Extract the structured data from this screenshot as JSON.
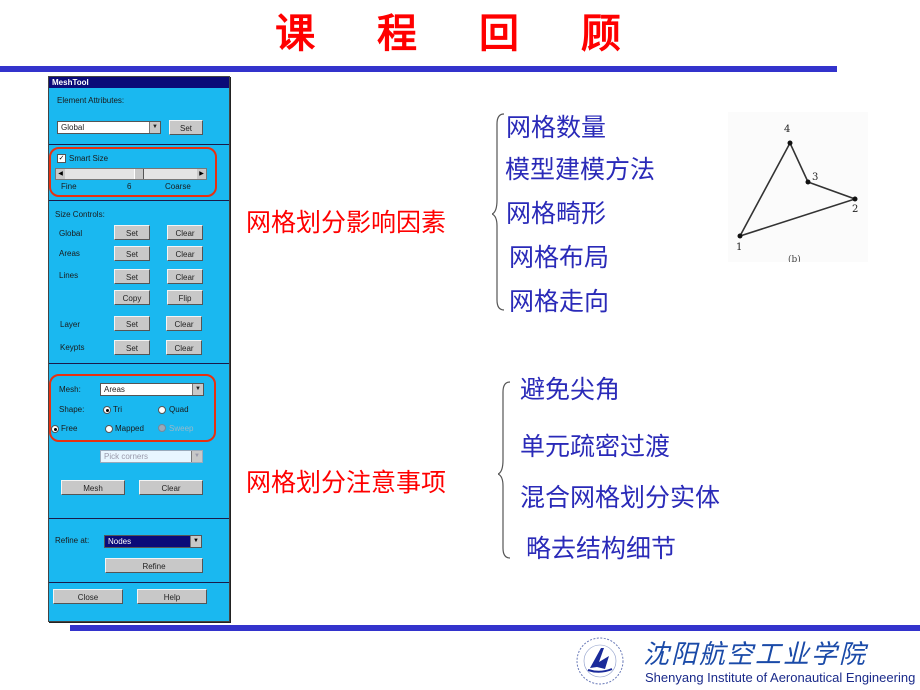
{
  "slide": {
    "title": "课 程 回 顾",
    "accent_color": "#3333cc",
    "title_color": "#ff0000",
    "item_color": "#2a2ab8"
  },
  "meshtool": {
    "window_title": "MeshTool",
    "element_attributes": {
      "label": "Element Attributes:",
      "select_value": "Global",
      "set_label": "Set"
    },
    "smart_size": {
      "checkbox_label": "Smart Size",
      "checked": true,
      "min_label": "Fine",
      "max_label": "Coarse",
      "value": "6",
      "min": 1,
      "max": 10
    },
    "size_controls": {
      "label": "Size Controls:",
      "rows": [
        {
          "label": "Global",
          "left_button": "Set",
          "right_button": "Clear"
        },
        {
          "label": "Areas",
          "left_button": "Set",
          "right_button": "Clear"
        },
        {
          "label": "Lines",
          "left_button": "Set",
          "right_button": "Clear"
        },
        {
          "label": "",
          "left_button": "Copy",
          "right_button": "Flip"
        },
        {
          "label": "Layer",
          "left_button": "Set",
          "right_button": "Clear"
        },
        {
          "label": "Keypts",
          "left_button": "Set",
          "right_button": "Clear"
        }
      ]
    },
    "mesh": {
      "label": "Mesh:",
      "select_value": "Areas",
      "shape_label": "Shape:",
      "shape_options": [
        {
          "label": "Tri",
          "selected": true
        },
        {
          "label": "Quad",
          "selected": false
        }
      ],
      "method_options": [
        {
          "label": "Free",
          "selected": true
        },
        {
          "label": "Mapped",
          "selected": false
        },
        {
          "label": "Sweep",
          "selected": false,
          "disabled": true
        }
      ],
      "pick_corners": "Pick corners",
      "mesh_button": "Mesh",
      "clear_button": "Clear"
    },
    "refine": {
      "label": "Refine at:",
      "select_value": "Nodes",
      "refine_button": "Refine"
    },
    "close_button": "Close",
    "help_button": "Help"
  },
  "factors": {
    "heading": "网格划分影响因素",
    "items": [
      "网格数量",
      "模型建模方法",
      "网格畸形",
      "网格布局",
      "网格走向"
    ]
  },
  "notes": {
    "heading": "网格划分注意事项",
    "items": [
      "避免尖角",
      "单元疏密过渡",
      "混合网格划分实体",
      "略去结构细节"
    ]
  },
  "diagram": {
    "nodes": [
      {
        "label": "1"
      },
      {
        "label": "2"
      },
      {
        "label": "3"
      },
      {
        "label": "4"
      }
    ],
    "caption": "(b)"
  },
  "footer": {
    "institution_cn": "沈阳航空工业学院",
    "institution_en": "Shenyang Institute of Aeronautical Engineering"
  }
}
